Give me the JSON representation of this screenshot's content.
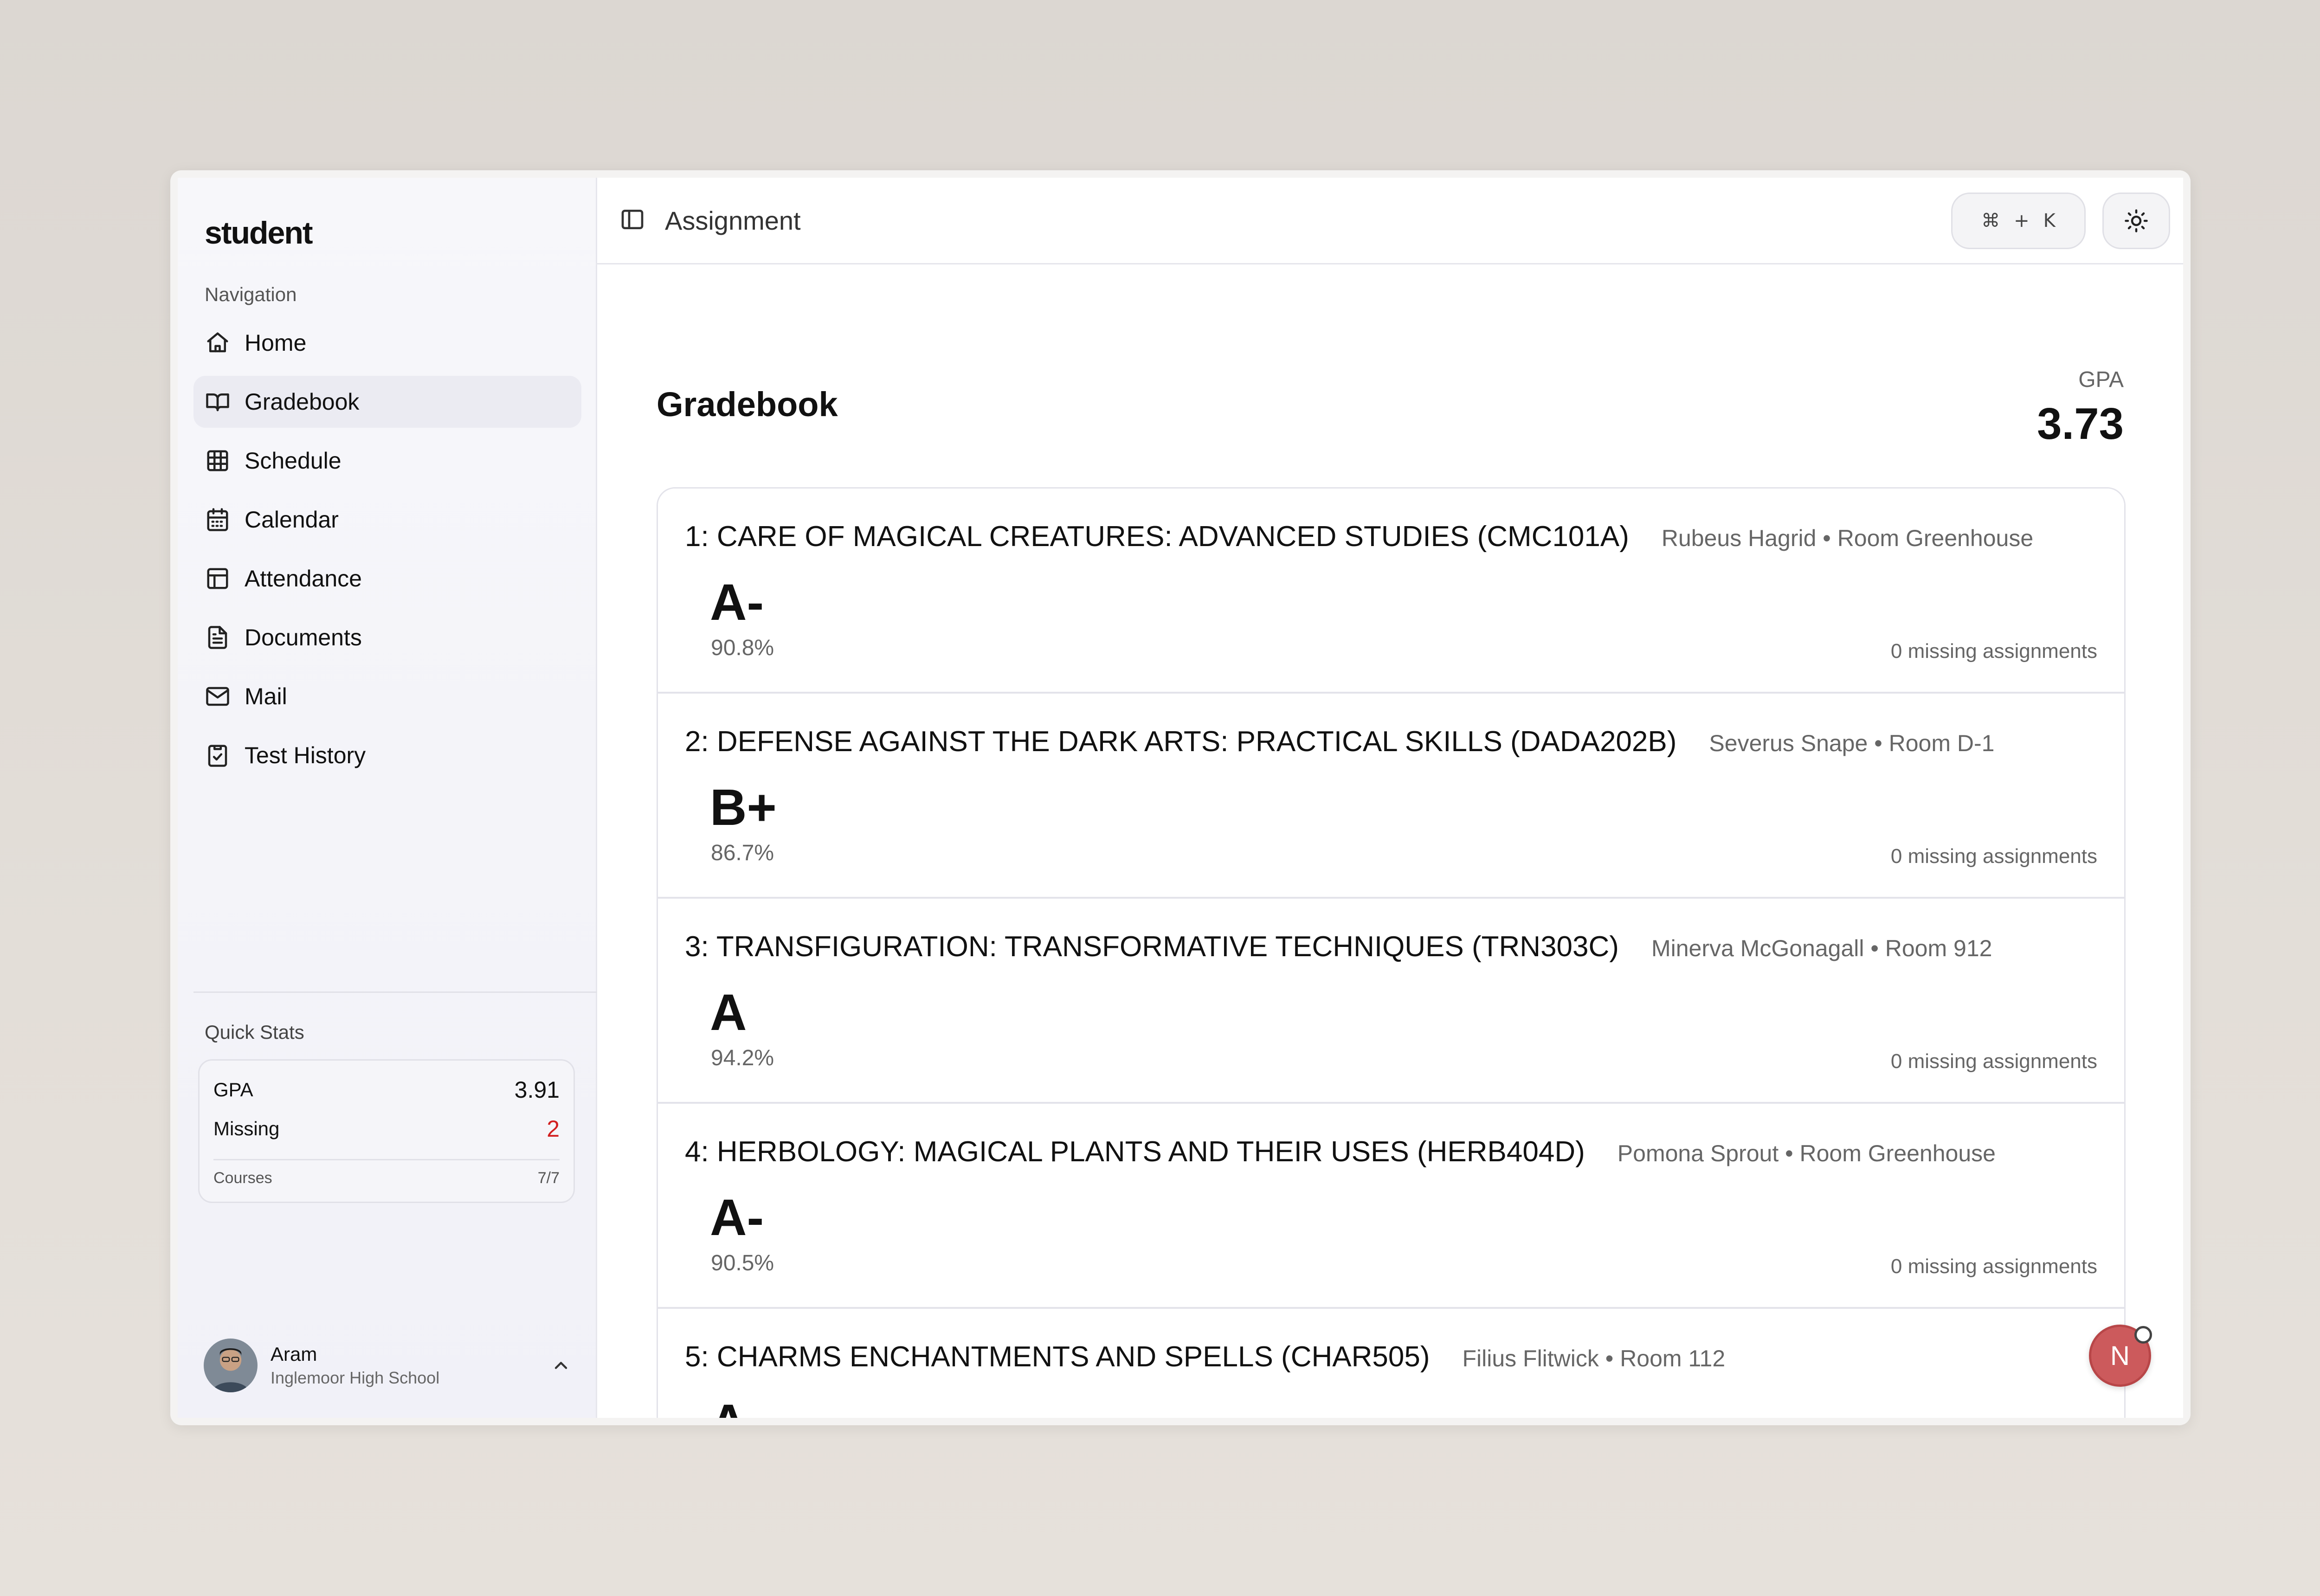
{
  "sidebar": {
    "brand": "student",
    "nav_title": "Navigation",
    "items": [
      {
        "label": "Home",
        "icon": "home-icon"
      },
      {
        "label": "Gradebook",
        "icon": "book-icon",
        "active": true
      },
      {
        "label": "Schedule",
        "icon": "grid-icon"
      },
      {
        "label": "Calendar",
        "icon": "calendar-icon"
      },
      {
        "label": "Attendance",
        "icon": "table-icon"
      },
      {
        "label": "Documents",
        "icon": "document-icon"
      },
      {
        "label": "Mail",
        "icon": "mail-icon"
      },
      {
        "label": "Test History",
        "icon": "clipboard-check-icon"
      }
    ],
    "quick_stats": {
      "title": "Quick Stats",
      "gpa_label": "GPA",
      "gpa_value": "3.91",
      "missing_label": "Missing",
      "missing_value": "2",
      "courses_label": "Courses",
      "courses_value": "7/7",
      "missing_color": "#d21f1f"
    },
    "user": {
      "name": "Aram",
      "school": "Inglemoor High School"
    }
  },
  "header": {
    "title": "Assignment",
    "shortcut": [
      "⌘",
      "+",
      "K"
    ]
  },
  "gradebook": {
    "title": "Gradebook",
    "gpa_label": "GPA",
    "gpa_value": "3.73",
    "courses": [
      {
        "name": "1: CARE OF MAGICAL CREATURES: ADVANCED STUDIES (CMC101A)",
        "meta": "Rubeus Hagrid • Room Greenhouse",
        "grade": "A-",
        "percent": "90.8%",
        "missing": "0 missing assignments"
      },
      {
        "name": "2: DEFENSE AGAINST THE DARK ARTS: PRACTICAL SKILLS (DADA202B)",
        "meta": "Severus Snape • Room D-1",
        "grade": "B+",
        "percent": "86.7%",
        "missing": "0 missing assignments"
      },
      {
        "name": "3: TRANSFIGURATION: TRANSFORMATIVE TECHNIQUES (TRN303C)",
        "meta": "Minerva McGonagall • Room 912",
        "grade": "A",
        "percent": "94.2%",
        "missing": "0 missing assignments"
      },
      {
        "name": "4: HERBOLOGY: MAGICAL PLANTS AND THEIR USES (HERB404D)",
        "meta": "Pomona Sprout • Room Greenhouse",
        "grade": "A-",
        "percent": "90.5%",
        "missing": "0 missing assignments"
      },
      {
        "name": "5: CHARMS ENCHANTMENTS AND SPELLS (CHAR505)",
        "meta": "Filius Flitwick • Room 112",
        "grade": "A",
        "percent": "",
        "missing": ""
      }
    ]
  },
  "fab": {
    "label": "N",
    "color": "#cc5a5c"
  }
}
